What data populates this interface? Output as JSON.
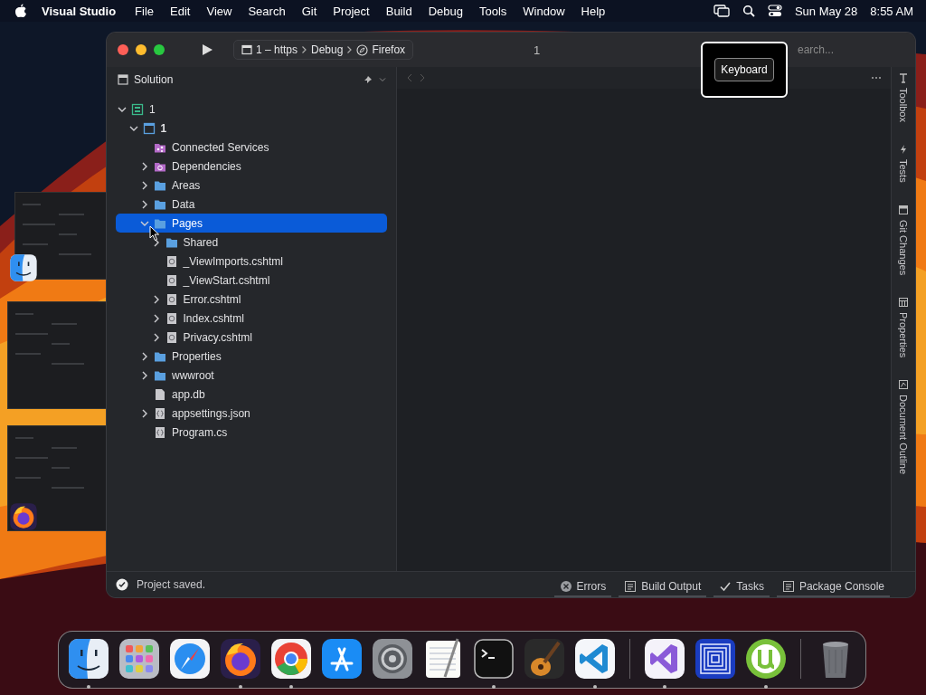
{
  "menu_bar": {
    "app_name": "Visual Studio",
    "menus": [
      "File",
      "Edit",
      "View",
      "Search",
      "Git",
      "Project",
      "Build",
      "Debug",
      "Tools",
      "Window",
      "Help"
    ],
    "date": "Sun May 28",
    "time": "8:55 AM"
  },
  "stage": [
    {
      "kind": "finder"
    },
    {
      "kind": "code"
    },
    {
      "kind": "firefox"
    }
  ],
  "window": {
    "run_config": [
      "1 – https",
      "Debug",
      "Firefox"
    ],
    "title": "1",
    "search": {
      "placeholder": "earch..."
    },
    "solution": {
      "title": "Solution",
      "tree": [
        {
          "label": "1",
          "kind": "solution",
          "expanded": true,
          "selected": false,
          "children": [
            {
              "label": "1",
              "kind": "project",
              "expanded": true,
              "selected": false,
              "children": [
                {
                  "label": "Connected Services",
                  "kind": "connected",
                  "selected": false
                },
                {
                  "label": "Dependencies",
                  "kind": "dependencies",
                  "expanded": false,
                  "selected": false
                },
                {
                  "label": "Areas",
                  "kind": "folder",
                  "expanded": false,
                  "selected": false
                },
                {
                  "label": "Data",
                  "kind": "folder",
                  "expanded": false,
                  "selected": false
                },
                {
                  "label": "Pages",
                  "kind": "folder",
                  "expanded": true,
                  "selected": true,
                  "children": [
                    {
                      "label": "Shared",
                      "kind": "folder",
                      "expanded": false,
                      "selected": false
                    },
                    {
                      "label": "_ViewImports.cshtml",
                      "kind": "razor",
                      "selected": false
                    },
                    {
                      "label": "_ViewStart.cshtml",
                      "kind": "razor",
                      "selected": false
                    },
                    {
                      "label": "Error.cshtml",
                      "kind": "razor",
                      "expanded": false,
                      "selected": false
                    },
                    {
                      "label": "Index.cshtml",
                      "kind": "razor",
                      "expanded": false,
                      "selected": false
                    },
                    {
                      "label": "Privacy.cshtml",
                      "kind": "razor",
                      "expanded": false,
                      "selected": false
                    }
                  ]
                },
                {
                  "label": "Properties",
                  "kind": "folder",
                  "expanded": false,
                  "selected": false
                },
                {
                  "label": "wwwroot",
                  "kind": "folder",
                  "expanded": false,
                  "selected": false
                },
                {
                  "label": "app.db",
                  "kind": "file",
                  "selected": false
                },
                {
                  "label": "appsettings.json",
                  "kind": "json",
                  "expanded": false,
                  "selected": false
                },
                {
                  "label": "Program.cs",
                  "kind": "json",
                  "selected": false
                }
              ]
            }
          ]
        }
      ]
    },
    "side_tabs": [
      {
        "label": "Toolbox",
        "kind": "toolbox"
      },
      {
        "label": "Tests",
        "kind": "tests"
      },
      {
        "label": "Git Changes",
        "kind": "git"
      },
      {
        "label": "Properties",
        "kind": "properties"
      },
      {
        "label": "Document Outline",
        "kind": "outline"
      }
    ],
    "status": "Project saved.",
    "bottom_tabs": [
      {
        "label": "Errors",
        "kind": "errors"
      },
      {
        "label": "Build Output",
        "kind": "output"
      },
      {
        "label": "Tasks",
        "kind": "tasks"
      },
      {
        "label": "Package Console",
        "kind": "output"
      }
    ]
  },
  "keyboard_overlay": {
    "label": "Keyboard"
  },
  "dock": {
    "groups": [
      [
        {
          "kind": "finder",
          "running": true
        },
        {
          "kind": "launchpad",
          "running": false
        },
        {
          "kind": "safari",
          "running": false
        },
        {
          "kind": "firefox",
          "running": true
        },
        {
          "kind": "chrome",
          "running": true
        },
        {
          "kind": "appstore",
          "running": false
        },
        {
          "kind": "settings",
          "running": false
        },
        {
          "kind": "textedit",
          "running": false
        },
        {
          "kind": "terminal",
          "running": true
        },
        {
          "kind": "garageband",
          "running": false
        },
        {
          "kind": "vscode",
          "running": true
        }
      ],
      [
        {
          "kind": "visualstudio",
          "running": true
        },
        {
          "kind": "squares",
          "running": false
        },
        {
          "kind": "utorrent",
          "running": true
        }
      ],
      [
        {
          "kind": "trash",
          "running": false
        }
      ]
    ]
  }
}
